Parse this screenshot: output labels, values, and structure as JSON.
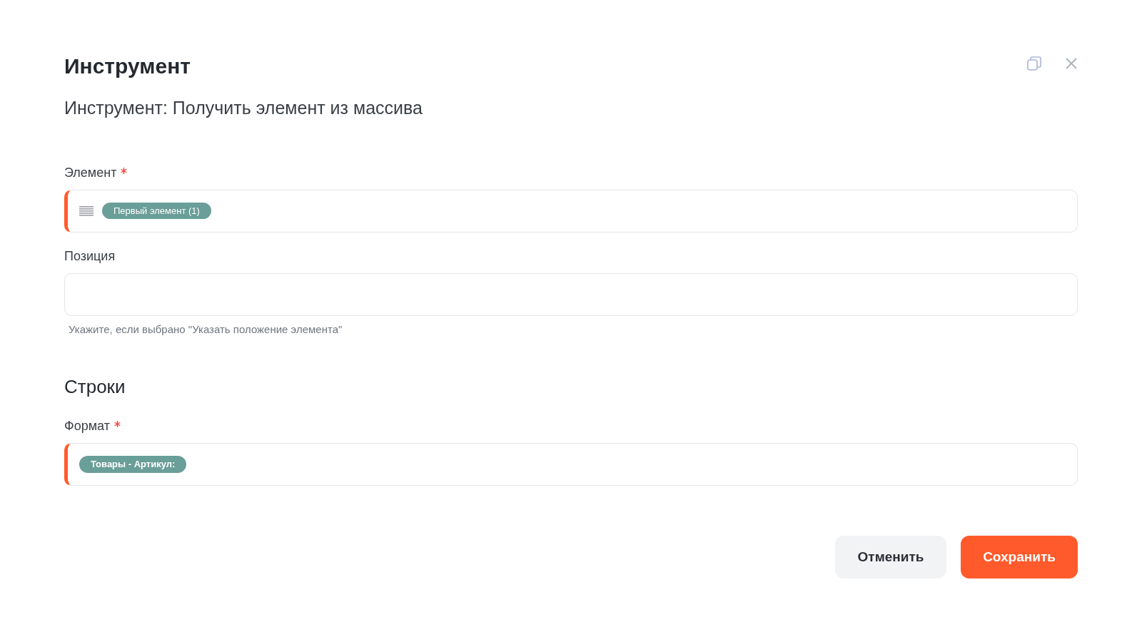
{
  "dialog": {
    "title": "Инструмент",
    "subtitle": "Инструмент: Получить элемент из массива"
  },
  "items": [
    {
      "kind": "list",
      "label": "Элемент",
      "required": true,
      "tokens": [
        "Первый элемент (1)"
      ]
    },
    {
      "kind": "text",
      "label": "Позиция",
      "required": false,
      "hint": "Укажите, если выбрано \"Указать положение элемента\""
    },
    {
      "kind": "heading",
      "label": "Строки"
    },
    {
      "kind": "text",
      "label": "Формат",
      "required": true,
      "tokens": [
        "Товары - Артикул:"
      ]
    }
  ],
  "buttons": [
    {
      "label": "Отменить",
      "kind": "secondary"
    },
    {
      "label": "Сохранить",
      "kind": "primary"
    }
  ]
}
